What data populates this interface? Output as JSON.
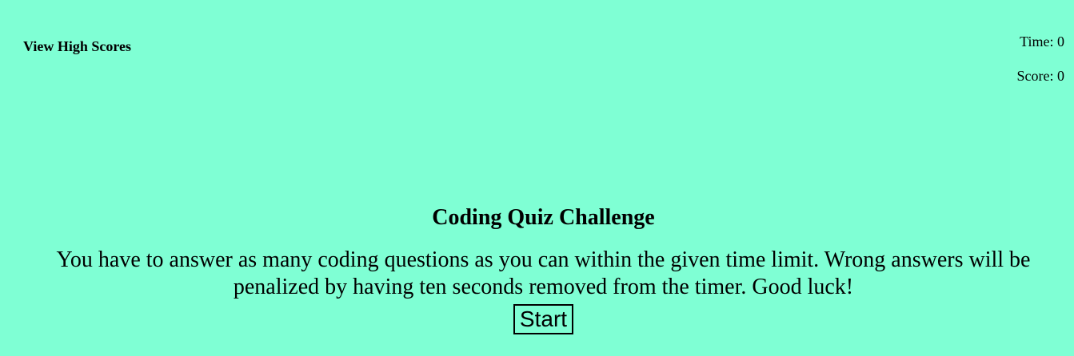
{
  "header": {
    "high_scores_link": "View High Scores",
    "time_label": "Time: 0",
    "score_label": "Score: 0"
  },
  "main": {
    "title": "Coding Quiz Challenge",
    "description": "You have to answer as many coding questions as you can within the given time limit. Wrong answers will be penalized by having ten seconds removed from the timer. Good luck!",
    "start_label": "Start"
  },
  "theme": {
    "background": "#7fffd4",
    "text": "#000000"
  }
}
